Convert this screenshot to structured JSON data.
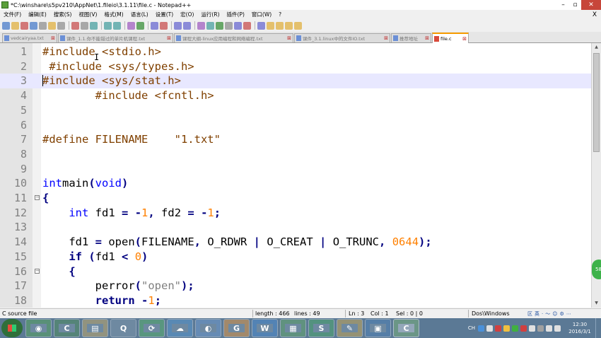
{
  "window": {
    "title": "*C:\\winshare\\s5pv210\\AppNet\\1.fileio\\3.1.11\\file.c - Notepad++"
  },
  "menu": [
    {
      "label": "文件(F)"
    },
    {
      "label": "编辑(E)"
    },
    {
      "label": "搜索(S)"
    },
    {
      "label": "视图(V)"
    },
    {
      "label": "格式(M)"
    },
    {
      "label": "语言(L)"
    },
    {
      "label": "设置(T)"
    },
    {
      "label": "宏(O)"
    },
    {
      "label": "运行(R)"
    },
    {
      "label": "插件(P)"
    },
    {
      "label": "窗口(W)"
    },
    {
      "label": "?"
    }
  ],
  "menu_close": "X",
  "toolbar": {
    "groups": [
      [
        "new-file",
        "open-file",
        "save",
        "save-all",
        "close",
        "close-all",
        "print"
      ],
      [
        "cut",
        "copy",
        "paste"
      ],
      [
        "undo",
        "redo"
      ],
      [
        "find",
        "replace"
      ],
      [
        "zoom-in",
        "zoom-out"
      ],
      [
        "sync-v",
        "sync-h"
      ],
      [
        "word-wrap",
        "show-all",
        "indent-guide",
        "doc-map",
        "function-list",
        "folder"
      ],
      [
        "record-macro",
        "stop-macro",
        "play-macro",
        "run-macro-multiple",
        "save-macro"
      ]
    ]
  },
  "tabs": [
    {
      "label": "vedcairyaa.txt",
      "active": false
    },
    {
      "label": "课件_1.1.你不能错过的单片机课程.txt",
      "active": false
    },
    {
      "label": "课程大纲-linux应用编程和网络编程.txt",
      "active": false
    },
    {
      "label": "课件_3.1.linux中的文件IO.txt",
      "active": false
    },
    {
      "label": "推荐地址",
      "active": false
    },
    {
      "label": "file.c",
      "active": true
    }
  ],
  "code_lines": [
    {
      "n": "1",
      "t": [
        [
          "pp",
          "#include <stdio.h>"
        ]
      ]
    },
    {
      "n": "2",
      "t": [
        [
          "pp",
          " #include <sys/types.h>"
        ]
      ]
    },
    {
      "n": "3",
      "t": [
        [
          "pp",
          "#include <sys/stat.h>"
        ]
      ]
    },
    {
      "n": "4",
      "t": [
        [
          "pp",
          "        #include <fcntl.h>"
        ]
      ]
    },
    {
      "n": "5",
      "t": []
    },
    {
      "n": "6",
      "t": []
    },
    {
      "n": "7",
      "t": [
        [
          "pp",
          "#define FILENAME    \"1.txt\""
        ]
      ]
    },
    {
      "n": "8",
      "t": []
    },
    {
      "n": "9",
      "t": []
    },
    {
      "n": "10",
      "t": [
        [
          "kw",
          "int"
        ],
        [
          "",
          "main"
        ],
        [
          "op",
          "("
        ],
        [
          "kw",
          "void"
        ],
        [
          "op",
          ")"
        ]
      ]
    },
    {
      "n": "11",
      "t": [
        [
          "op",
          "{"
        ]
      ]
    },
    {
      "n": "12",
      "t": [
        [
          "",
          "    "
        ],
        [
          "kw",
          "int"
        ],
        [
          "",
          " fd1 "
        ],
        [
          "op",
          "="
        ],
        [
          "",
          " "
        ],
        [
          "op",
          "-"
        ],
        [
          "num",
          "1"
        ],
        [
          "op",
          ","
        ],
        [
          "",
          " fd2 "
        ],
        [
          "op",
          "="
        ],
        [
          "",
          " "
        ],
        [
          "op",
          "-"
        ],
        [
          "num",
          "1"
        ],
        [
          "op",
          ";"
        ]
      ]
    },
    {
      "n": "13",
      "t": []
    },
    {
      "n": "14",
      "t": [
        [
          "",
          "    fd1 "
        ],
        [
          "op",
          "="
        ],
        [
          "",
          " open"
        ],
        [
          "op",
          "("
        ],
        [
          "",
          "FILENAME"
        ],
        [
          "op",
          ","
        ],
        [
          "",
          " O_RDWR "
        ],
        [
          "op",
          "|"
        ],
        [
          "",
          " O_CREAT "
        ],
        [
          "op",
          "|"
        ],
        [
          "",
          " O_TRUNC"
        ],
        [
          "op",
          ","
        ],
        [
          "",
          " "
        ],
        [
          "num",
          "0644"
        ],
        [
          "op",
          ");"
        ]
      ]
    },
    {
      "n": "15",
      "t": [
        [
          "",
          "    "
        ],
        [
          "kb",
          "if"
        ],
        [
          "",
          " "
        ],
        [
          "op",
          "("
        ],
        [
          "",
          "fd1 "
        ],
        [
          "op",
          "<"
        ],
        [
          "",
          " "
        ],
        [
          "num",
          "0"
        ],
        [
          "op",
          ")"
        ]
      ]
    },
    {
      "n": "16",
      "t": [
        [
          "",
          "    "
        ],
        [
          "op",
          "{"
        ]
      ]
    },
    {
      "n": "17",
      "t": [
        [
          "",
          "        perror"
        ],
        [
          "op",
          "("
        ],
        [
          "str",
          "\"open\""
        ],
        [
          "op",
          ");"
        ]
      ]
    },
    {
      "n": "18",
      "t": [
        [
          "",
          "        "
        ],
        [
          "kb",
          "return"
        ],
        [
          "",
          " "
        ],
        [
          "op",
          "-"
        ],
        [
          "num",
          "1"
        ],
        [
          "op",
          ";"
        ]
      ]
    }
  ],
  "fold_markers": {
    "11": "−",
    "16": "−"
  },
  "current_line": 3,
  "status": {
    "filetype": "C source file",
    "length": "length : 466",
    "lines": "lines : 49",
    "ln": "Ln : 3",
    "col": "Col : 1",
    "sel": "Sel : 0 | 0",
    "eol": "Dos\\Windows",
    "ime": [
      "区",
      "英",
      "·",
      "〜",
      "☺",
      "⚙",
      "⋯"
    ]
  },
  "floating_badge": "58",
  "taskbar": {
    "apps": [
      {
        "name": "chrome-app",
        "glyph": "◉",
        "active": false
      },
      {
        "name": "notepadpp-app",
        "glyph": "C",
        "active": false
      },
      {
        "name": "explorer-app",
        "glyph": "▤",
        "active": false
      },
      {
        "name": "qq-app",
        "glyph": "Q",
        "active": false
      },
      {
        "name": "refresh-app",
        "glyph": "⟳",
        "active": false
      },
      {
        "name": "cloud-app",
        "glyph": "☁",
        "active": false
      },
      {
        "name": "browser-app",
        "glyph": "◐",
        "active": false
      },
      {
        "name": "pdf-app",
        "glyph": "G",
        "active": false
      },
      {
        "name": "word-app",
        "glyph": "W",
        "active": false
      },
      {
        "name": "chart-app",
        "glyph": "▦",
        "active": false
      },
      {
        "name": "sheets-app",
        "glyph": "S",
        "active": false
      },
      {
        "name": "tools-app",
        "glyph": "✎",
        "active": false
      },
      {
        "name": "virtualbox-app",
        "glyph": "▣",
        "active": false
      },
      {
        "name": "notepadpp-active-app",
        "glyph": "C",
        "active": true
      }
    ],
    "tray_label": "CH",
    "clock_time": "12:30",
    "clock_date": "2016/3/1"
  }
}
